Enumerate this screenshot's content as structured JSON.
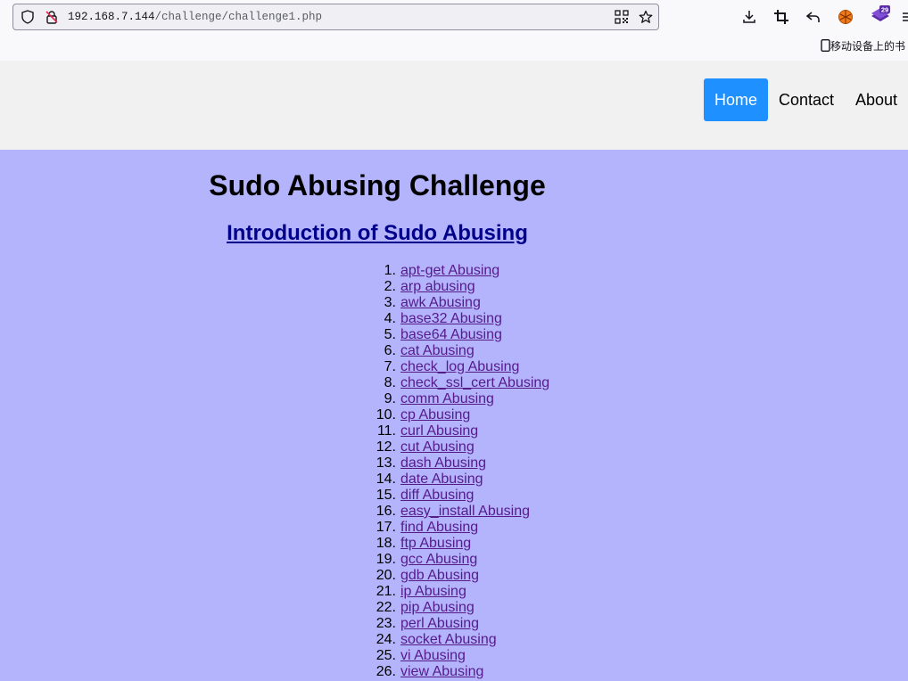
{
  "browser": {
    "url_host": "192.168.7.144",
    "url_path": "/challenge/challenge1.php",
    "mobile_bookmarks": "移动设备上的书",
    "badge_count": "29"
  },
  "nav": {
    "home": "Home",
    "contact": "Contact",
    "about": "About"
  },
  "page": {
    "title": "Sudo Abusing Challenge",
    "intro_link": "Introduction of Sudo Abusing",
    "items": [
      {
        "num": "1.",
        "label": "apt-get Abusing"
      },
      {
        "num": "2.",
        "label": "arp abusing"
      },
      {
        "num": "3.",
        "label": "awk Abusing"
      },
      {
        "num": "4.",
        "label": "base32 Abusing"
      },
      {
        "num": "5.",
        "label": "base64 Abusing"
      },
      {
        "num": "6.",
        "label": "cat Abusing"
      },
      {
        "num": "7.",
        "label": "check_log Abusing"
      },
      {
        "num": "8.",
        "label": "check_ssl_cert Abusing"
      },
      {
        "num": "9.",
        "label": "comm Abusing"
      },
      {
        "num": "10.",
        "label": "cp Abusing"
      },
      {
        "num": "11.",
        "label": "curl Abusing"
      },
      {
        "num": "12.",
        "label": "cut Abusing"
      },
      {
        "num": "13.",
        "label": "dash Abusing"
      },
      {
        "num": "14.",
        "label": "date Abusing"
      },
      {
        "num": "15.",
        "label": "diff Abusing"
      },
      {
        "num": "16.",
        "label": "easy_install Abusing"
      },
      {
        "num": "17.",
        "label": "find Abusing"
      },
      {
        "num": "18.",
        "label": "ftp Abusing"
      },
      {
        "num": "19.",
        "label": "gcc Abusing"
      },
      {
        "num": "20.",
        "label": "gdb Abusing"
      },
      {
        "num": "21.",
        "label": "ip Abusing"
      },
      {
        "num": "22.",
        "label": "pip Abusing"
      },
      {
        "num": "23.",
        "label": "perl Abusing"
      },
      {
        "num": "24.",
        "label": "socket Abusing"
      },
      {
        "num": "25.",
        "label": "vi Abusing"
      },
      {
        "num": "26.",
        "label": "view Abusing"
      }
    ]
  },
  "colors": {
    "page_bg": "#b4b4fd",
    "header_bg": "#f1f1f1",
    "nav_active": "#1e90ff",
    "link": "#551a8b",
    "intro_link": "#00008b"
  }
}
